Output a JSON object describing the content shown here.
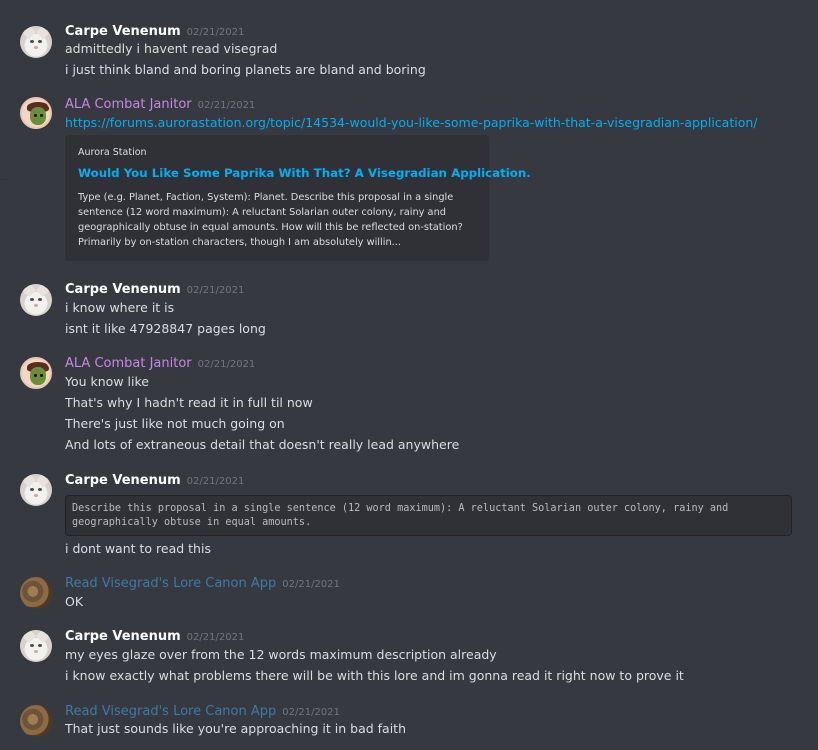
{
  "messages": [
    {
      "author": "Carpe Venenum",
      "timestamp": "02/21/2021",
      "lines": [
        "admittedly i havent read visegrad",
        "i just think bland and boring planets are bland and boring"
      ]
    },
    {
      "author": "ALA Combat Janitor",
      "timestamp": "02/21/2021",
      "link": "https://forums.aurorastation.org/topic/14534-would-you-like-some-paprika-with-that-a-visegradian-application/",
      "embed": {
        "provider": "Aurora Station",
        "title": "Would You Like Some Paprika With That? A Visegradian Application.",
        "description_lines": [
          "Type (e.g. Planet, Faction, System): Planet. Describe this proposal in a single",
          "sentence (12 word maximum): A reluctant Solarian outer colony, rainy and",
          "geographically obtuse in equal amounts. How will this be reflected on-station?",
          "Primarily by on-station characters, though I am absolutely willin..."
        ]
      }
    },
    {
      "author": "Carpe Venenum",
      "timestamp": "02/21/2021",
      "lines": [
        "i know where it is",
        "isnt it like 47928847 pages long"
      ]
    },
    {
      "author": "ALA Combat Janitor",
      "timestamp": "02/21/2021",
      "lines": [
        "You know like",
        "That's why I hadn't read it in full til now",
        "There's just like not much going on",
        "And lots of extraneous detail that doesn't really lead anywhere"
      ]
    },
    {
      "author": "Carpe Venenum",
      "timestamp": "02/21/2021",
      "code_lines": [
        "Describe this proposal in a single sentence (12 word maximum): A reluctant Solarian outer colony, rainy and",
        "geographically obtuse in equal amounts."
      ],
      "lines": [
        "i dont want to read this"
      ]
    },
    {
      "author": "Read Visegrad's Lore Canon App",
      "timestamp": "02/21/2021",
      "lines": [
        "OK"
      ]
    },
    {
      "author": "Carpe Venenum",
      "timestamp": "02/21/2021",
      "lines": [
        "my eyes glaze over from the 12 words maximum description already",
        "i know exactly what problems there will be with this lore and im gonna read it right now to prove it"
      ]
    },
    {
      "author": "Read Visegrad's Lore Canon App",
      "timestamp": "02/21/2021",
      "lines": [
        "That just sounds like you're approaching it in bad faith"
      ]
    }
  ],
  "colors": {
    "background": "#36393f",
    "embed_background": "#2f3136",
    "link": "#00aff4",
    "name_white": "#ffffff",
    "name_purple": "#c687e5",
    "name_blue": "#3b7ca8",
    "timestamp": "#72767d"
  },
  "icons": [
    "cat-avatar-icon",
    "green-character-avatar-icon",
    "rock-avatar-icon"
  ]
}
